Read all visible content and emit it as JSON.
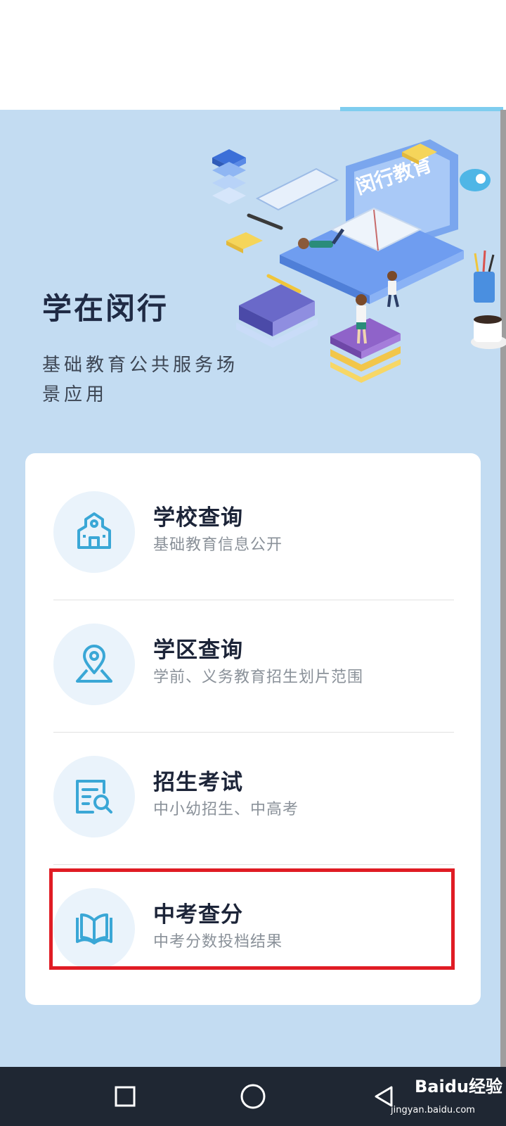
{
  "hero": {
    "title": "学在闵行",
    "subtitle": "基础教育公共服务场景应用",
    "illustration_sign": "闵行教育"
  },
  "menu": {
    "items": [
      {
        "title": "学校查询",
        "subtitle": "基础教育信息公开",
        "icon": "school-building-icon"
      },
      {
        "title": "学区查询",
        "subtitle": "学前、义务教育招生划片范围",
        "icon": "location-pin-icon"
      },
      {
        "title": "招生考试",
        "subtitle": "中小幼招生、中高考",
        "icon": "document-search-icon"
      },
      {
        "title": "中考查分",
        "subtitle": "中考分数投档结果",
        "icon": "open-book-icon"
      }
    ]
  },
  "navbar": {
    "buttons": [
      "recent-apps-square",
      "home-circle",
      "back-triangle"
    ]
  },
  "watermark": {
    "brand": "Baidu经验",
    "url": "jingyan.baidu.com"
  },
  "colors": {
    "hero_bg": "#c3dcf2",
    "accent": "#3aa7d6",
    "highlight": "#e01c24",
    "navbar": "#1f2733"
  }
}
